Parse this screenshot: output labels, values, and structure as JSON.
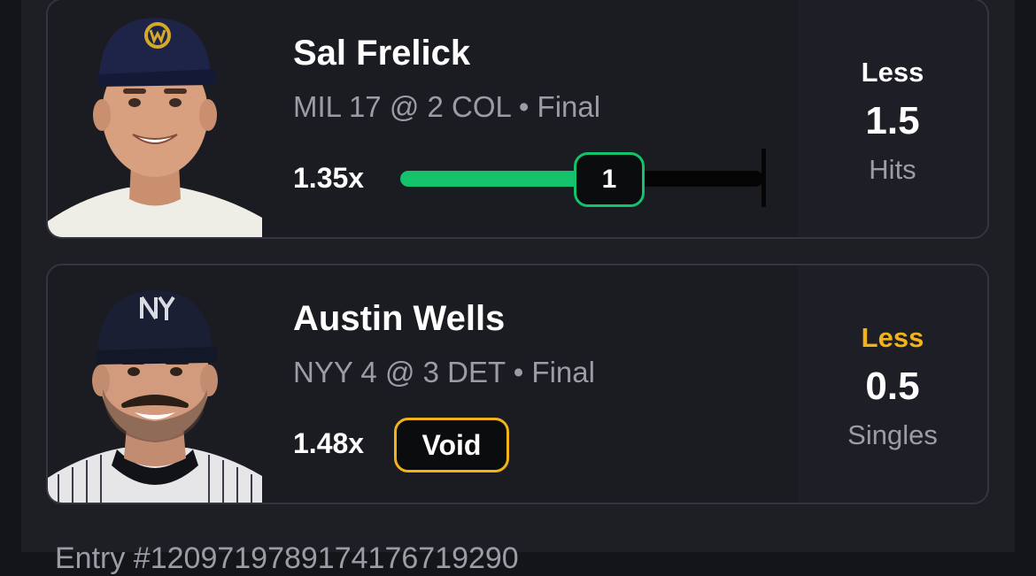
{
  "picks": [
    {
      "player_name": "Sal Frelick",
      "game_info": "MIL 17 @ 2 COL • Final",
      "multiplier": "1.35x",
      "result_value": "1",
      "result_progress": 0.67,
      "direction": "Less",
      "direction_color": "#ffffff",
      "line": "1.5",
      "stat": "Hits",
      "cap_logo": "brewers-logo-icon"
    },
    {
      "player_name": "Austin Wells",
      "game_info": "NYY 4 @ 3 DET • Final",
      "multiplier": "1.48x",
      "status": "Void",
      "direction": "Less",
      "direction_color": "#f2b31a",
      "line": "0.5",
      "stat": "Singles",
      "cap_logo": "yankees-logo-icon"
    }
  ],
  "colors": {
    "success": "#13c26b",
    "void": "#f2b31a",
    "background": "#141519",
    "card": "#1b1c22"
  },
  "footer": {
    "entry_text": "Entry #1209719789174176719290"
  }
}
